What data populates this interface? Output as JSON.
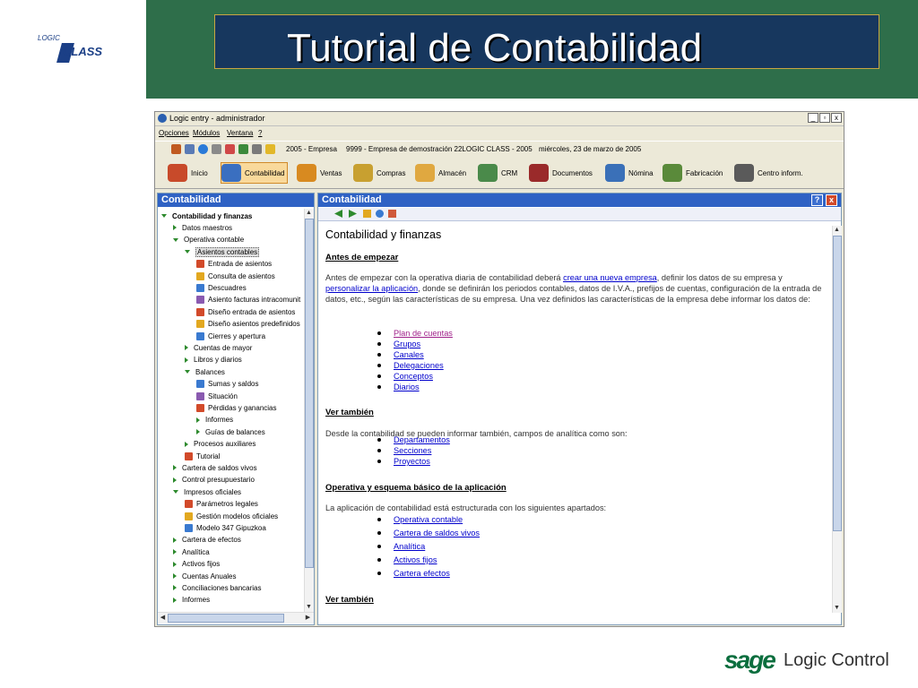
{
  "slide": {
    "title": "Tutorial de Contabilidad",
    "logo": {
      "logic": "LOGIC",
      "class": "CLASS"
    },
    "footer": {
      "sage": "sage",
      "brand": "Logic Control"
    },
    "colors": {
      "header_band": "#2e6e4a",
      "title_box": "#17375e",
      "accent": "#2f62c4"
    }
  },
  "window": {
    "title": "Logic entry - administrador",
    "controls": [
      "_",
      "▫",
      "x"
    ],
    "menu": [
      "Opciones",
      "Módulos",
      "Ventana",
      "?"
    ],
    "toolbar": {
      "empresa": "2005 - Empresa",
      "demo": "9999 - Empresa de demostración  22LOGIC CLASS - 2005",
      "fecha": "miércoles, 23 de marzo de 2005"
    },
    "modules": [
      "Inicio",
      "Contabilidad",
      "Ventas",
      "Compras",
      "Almacén",
      "CRM",
      "Documentos",
      "Nómina",
      "Fabricación",
      "Centro inform."
    ],
    "active_module": "Contabilidad"
  },
  "left_panel": {
    "header": "Contabilidad",
    "tree": [
      {
        "label": "Contabilidad y finanzas",
        "level": 0,
        "icon": "down",
        "bold": true
      },
      {
        "label": "Datos maestros",
        "level": 1,
        "icon": "right"
      },
      {
        "label": "Operativa contable",
        "level": 1,
        "icon": "down"
      },
      {
        "label": "Asientos contables",
        "level": 2,
        "icon": "down",
        "selected": true
      },
      {
        "label": "Entrada de asientos",
        "level": 3,
        "icon": "doc"
      },
      {
        "label": "Consulta de asientos",
        "level": 3,
        "icon": "doc"
      },
      {
        "label": "Descuadres",
        "level": 3,
        "icon": "doc"
      },
      {
        "label": "Asiento facturas intracomunit",
        "level": 3,
        "icon": "doc"
      },
      {
        "label": "Diseño entrada de asientos",
        "level": 3,
        "icon": "doc"
      },
      {
        "label": "Diseño asientos predefinidos",
        "level": 3,
        "icon": "doc"
      },
      {
        "label": "Cierres y apertura",
        "level": 3,
        "icon": "doc"
      },
      {
        "label": "Cuentas de mayor",
        "level": 2,
        "icon": "right"
      },
      {
        "label": "Libros y diarios",
        "level": 2,
        "icon": "right"
      },
      {
        "label": "Balances",
        "level": 2,
        "icon": "down"
      },
      {
        "label": "Sumas y saldos",
        "level": 3,
        "icon": "doc"
      },
      {
        "label": "Situación",
        "level": 3,
        "icon": "doc"
      },
      {
        "label": "Pérdidas y ganancias",
        "level": 3,
        "icon": "doc"
      },
      {
        "label": "Informes",
        "level": 3,
        "icon": "right"
      },
      {
        "label": "Guías de balances",
        "level": 3,
        "icon": "right"
      },
      {
        "label": "Procesos auxiliares",
        "level": 2,
        "icon": "right"
      },
      {
        "label": "Tutorial",
        "level": 2,
        "icon": "doc"
      },
      {
        "label": "Cartera de saldos vivos",
        "level": 1,
        "icon": "right"
      },
      {
        "label": "Control presupuestario",
        "level": 1,
        "icon": "right"
      },
      {
        "label": "Impresos oficiales",
        "level": 1,
        "icon": "down"
      },
      {
        "label": "Parámetros legales",
        "level": 2,
        "icon": "doc"
      },
      {
        "label": "Gestión modelos oficiales",
        "level": 2,
        "icon": "doc"
      },
      {
        "label": "Modelo 347 Gipuzkoa",
        "level": 2,
        "icon": "doc"
      },
      {
        "label": "Cartera de efectos",
        "level": 1,
        "icon": "right"
      },
      {
        "label": "Analítica",
        "level": 1,
        "icon": "right"
      },
      {
        "label": "Activos fijos",
        "level": 1,
        "icon": "right"
      },
      {
        "label": "Cuentas Anuales",
        "level": 1,
        "icon": "right"
      },
      {
        "label": "Conciliaciones bancarias",
        "level": 1,
        "icon": "right"
      },
      {
        "label": "Informes",
        "level": 1,
        "icon": "right"
      }
    ]
  },
  "right_panel": {
    "header": "Contabilidad",
    "help": "?",
    "close": "x",
    "content": {
      "title": "Contabilidad y finanzas",
      "sec1_heading": "Antes de empezar",
      "sec1_p_a": "Antes de empezar con la operativa diaria de contabilidad deberá",
      "sec1_link1": "crear una nueva empresa",
      "sec1_p_b": ", definir los datos de su empresa",
      "sec1_p_c": "y",
      "sec1_link2": "personalizar la aplicación",
      "sec1_p_d": ", donde se definirán los periodos contables, datos de I.V.A., prefijos de cuentas, configuración de la entrada de datos, etc.,  según las características de su empresa. Una vez definidos las características de la empresa debe informar los datos de:",
      "list1": [
        "Plan de cuentas",
        "Grupos",
        "Canales",
        "Delegaciones",
        "Conceptos",
        "Diarios"
      ],
      "sec2_heading": "Ver también",
      "sec2_p": "Desde la contabilidad se pueden informar también, campos de analítica como son:",
      "list2": [
        "Departamentos",
        "Secciones",
        "Proyectos"
      ],
      "sec3_heading": "Operativa y esquema básico de la aplicación",
      "sec3_p": "La aplicación de contabilidad está estructurada con los siguientes apartados:",
      "list3": [
        "Operativa contable",
        "Cartera de saldos vivos",
        "Analítica",
        "Activos fijos",
        "Cartera efectos"
      ],
      "cutoff_heading": "Ver también"
    }
  }
}
